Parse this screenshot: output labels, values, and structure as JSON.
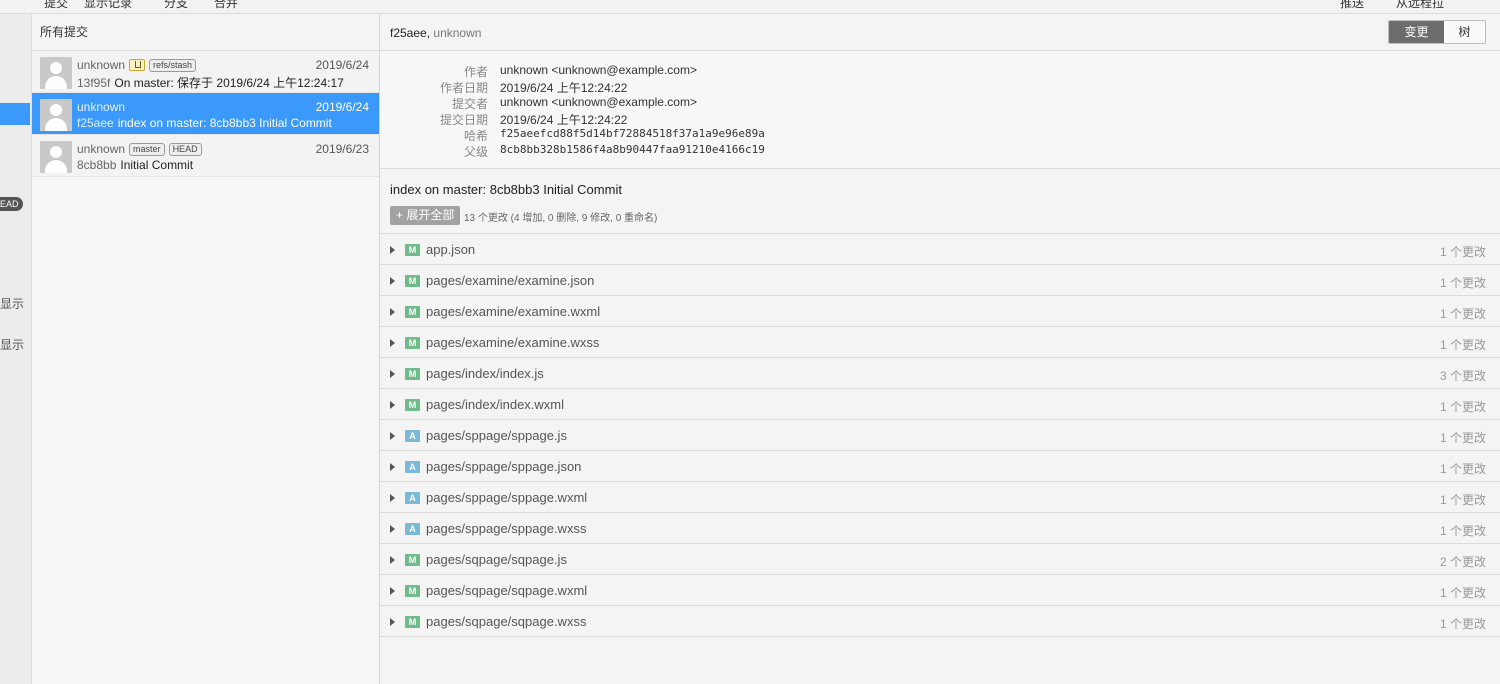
{
  "topbar": {
    "left_items": [
      "提交",
      "显示记录",
      "分支",
      "合并"
    ],
    "right_items": [
      "推送",
      "从远程拉"
    ]
  },
  "left_sidebar": {
    "badge": "EAD",
    "hints": [
      "显示",
      "显示"
    ]
  },
  "commit_list": {
    "header": "所有提交",
    "commits": [
      {
        "author": "unknown",
        "date": "2019/6/24",
        "hash": "13f95f",
        "message": "On master: 保存于 2019/6/24 上午12:24:17",
        "tags": [
          "refs/stash"
        ],
        "stash": true
      },
      {
        "author": "unknown",
        "date": "2019/6/24",
        "hash": "f25aee",
        "message": "index on master: 8cb8bb3 Initial Commit",
        "tags": [],
        "stash": false
      },
      {
        "author": "unknown",
        "date": "2019/6/23",
        "hash": "8cb8bb",
        "message": "Initial Commit",
        "tags": [
          "master",
          "HEAD"
        ],
        "stash": false
      }
    ]
  },
  "detail": {
    "title_hash": "f25aee",
    "title_sep": ",",
    "title_author": "unknown",
    "toggle": {
      "changes": "变更",
      "tree": "树"
    },
    "meta": [
      {
        "key": "作者",
        "value": "unknown <unknown@example.com>"
      },
      {
        "key": "作者日期",
        "value": "2019/6/24 上午12:24:22"
      },
      {
        "key": "提交者",
        "value": "unknown <unknown@example.com>"
      },
      {
        "key": "提交日期",
        "value": "2019/6/24 上午12:24:22"
      },
      {
        "key": "哈希",
        "value": "f25aeefcd88f5d14bf72884518f37a1a9e96e89a"
      },
      {
        "key": "父级",
        "value": "8cb8bb328b1586f4a8b90447faa91210e4166c19"
      }
    ],
    "message": "index on master: 8cb8bb3 Initial Commit",
    "expand_label": "+ 展开全部",
    "summary": "13 个更改 (4 增加, 0 删除, 9 修改, 0 重命名)",
    "files": [
      {
        "status": "M",
        "path": "app.json",
        "count": "1 个更改"
      },
      {
        "status": "M",
        "path": "pages/examine/examine.json",
        "count": "1 个更改"
      },
      {
        "status": "M",
        "path": "pages/examine/examine.wxml",
        "count": "1 个更改"
      },
      {
        "status": "M",
        "path": "pages/examine/examine.wxss",
        "count": "1 个更改"
      },
      {
        "status": "M",
        "path": "pages/index/index.js",
        "count": "3 个更改"
      },
      {
        "status": "M",
        "path": "pages/index/index.wxml",
        "count": "1 个更改"
      },
      {
        "status": "A",
        "path": "pages/sppage/sppage.js",
        "count": "1 个更改"
      },
      {
        "status": "A",
        "path": "pages/sppage/sppage.json",
        "count": "1 个更改"
      },
      {
        "status": "A",
        "path": "pages/sppage/sppage.wxml",
        "count": "1 个更改"
      },
      {
        "status": "A",
        "path": "pages/sppage/sppage.wxss",
        "count": "1 个更改"
      },
      {
        "status": "M",
        "path": "pages/sqpage/sqpage.js",
        "count": "2 个更改"
      },
      {
        "status": "M",
        "path": "pages/sqpage/sqpage.wxml",
        "count": "1 个更改"
      },
      {
        "status": "M",
        "path": "pages/sqpage/sqpage.wxss",
        "count": "1 个更改"
      }
    ]
  }
}
